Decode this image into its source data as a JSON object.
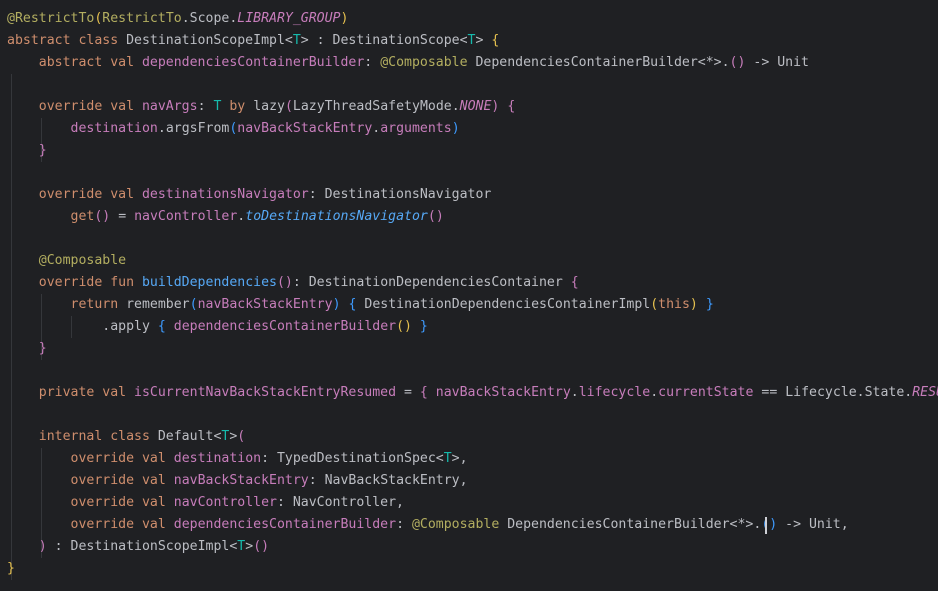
{
  "editor": {
    "language": "kotlin",
    "theme_colors": {
      "background": "#1f2023",
      "keyword": "#cf8e6d",
      "annotation": "#b3ae60",
      "property": "#c77dbb",
      "function": "#56a8f5",
      "type_parameter": "#16baac",
      "plain": "#bcbec4"
    },
    "lines": [
      [
        [
          "anno",
          "@RestrictTo"
        ],
        [
          "br1",
          "("
        ],
        [
          "anno",
          "RestrictTo"
        ],
        [
          "pl",
          ".Scope."
        ],
        [
          "prop ital",
          "LIBRARY_GROUP"
        ],
        [
          "br1",
          ")"
        ]
      ],
      [
        [
          "kw",
          "abstract class "
        ],
        [
          "ty",
          "DestinationScopeImpl"
        ],
        [
          "pl",
          "<"
        ],
        [
          "tp",
          "T"
        ],
        [
          "pl",
          "> : DestinationScope<"
        ],
        [
          "tp",
          "T"
        ],
        [
          "pl",
          "> "
        ],
        [
          "br1",
          "{"
        ]
      ],
      [
        [
          "pl",
          "    "
        ],
        [
          "kw",
          "abstract val "
        ],
        [
          "prop",
          "dependenciesContainerBuilder"
        ],
        [
          "pl",
          ": "
        ],
        [
          "anno",
          "@Composable "
        ],
        [
          "pl",
          "DependenciesContainerBuilder<*>."
        ],
        [
          "br2",
          "()"
        ],
        [
          "pl",
          " -> Unit"
        ]
      ],
      [],
      [
        [
          "pl",
          "    "
        ],
        [
          "kw",
          "override val "
        ],
        [
          "prop",
          "navArgs"
        ],
        [
          "pl",
          ": "
        ],
        [
          "tp",
          "T"
        ],
        [
          "pl",
          " "
        ],
        [
          "kw",
          "by "
        ],
        [
          "pl",
          "lazy"
        ],
        [
          "br2",
          "("
        ],
        [
          "pl",
          "LazyThreadSafetyMode."
        ],
        [
          "prop ital",
          "NONE"
        ],
        [
          "br2",
          ")"
        ],
        [
          "pl",
          " "
        ],
        [
          "br2",
          "{"
        ]
      ],
      [
        [
          "pl",
          "        "
        ],
        [
          "prop",
          "destination"
        ],
        [
          "pl",
          ".argsFrom"
        ],
        [
          "br3",
          "("
        ],
        [
          "prop",
          "navBackStackEntry"
        ],
        [
          "pl",
          "."
        ],
        [
          "prop",
          "arguments"
        ],
        [
          "br3",
          ")"
        ]
      ],
      [
        [
          "pl",
          "    "
        ],
        [
          "br2",
          "}"
        ]
      ],
      [],
      [
        [
          "pl",
          "    "
        ],
        [
          "kw",
          "override val "
        ],
        [
          "prop",
          "destinationsNavigator"
        ],
        [
          "pl",
          ": DestinationsNavigator"
        ]
      ],
      [
        [
          "pl",
          "        "
        ],
        [
          "kw",
          "get"
        ],
        [
          "br2",
          "()"
        ],
        [
          "pl",
          " = "
        ],
        [
          "prop",
          "navController"
        ],
        [
          "pl",
          "."
        ],
        [
          "fn ital",
          "toDestinationsNavigator"
        ],
        [
          "br2",
          "()"
        ]
      ],
      [],
      [
        [
          "pl",
          "    "
        ],
        [
          "anno",
          "@Composable"
        ]
      ],
      [
        [
          "pl",
          "    "
        ],
        [
          "kw",
          "override fun "
        ],
        [
          "fn",
          "buildDependencies"
        ],
        [
          "br2",
          "()"
        ],
        [
          "pl",
          ": DestinationDependenciesContainer "
        ],
        [
          "br2",
          "{"
        ]
      ],
      [
        [
          "pl",
          "        "
        ],
        [
          "kw",
          "return "
        ],
        [
          "pl",
          "remember"
        ],
        [
          "br3",
          "("
        ],
        [
          "prop",
          "navBackStackEntry"
        ],
        [
          "br3",
          ")"
        ],
        [
          "pl",
          " "
        ],
        [
          "br3",
          "{"
        ],
        [
          "pl",
          " DestinationDependenciesContainerImpl"
        ],
        [
          "br1",
          "("
        ],
        [
          "kw",
          "this"
        ],
        [
          "br1",
          ")"
        ],
        [
          "pl",
          " "
        ],
        [
          "br3",
          "}"
        ]
      ],
      [
        [
          "pl",
          "            .apply "
        ],
        [
          "br3",
          "{"
        ],
        [
          "pl",
          " "
        ],
        [
          "prop",
          "dependenciesContainerBuilder"
        ],
        [
          "br1",
          "()"
        ],
        [
          "pl",
          " "
        ],
        [
          "br3",
          "}"
        ]
      ],
      [
        [
          "pl",
          "    "
        ],
        [
          "br2",
          "}"
        ]
      ],
      [],
      [
        [
          "pl",
          "    "
        ],
        [
          "kw",
          "private val "
        ],
        [
          "prop",
          "isCurrentNavBackStackEntryResumed"
        ],
        [
          "pl",
          " = "
        ],
        [
          "br2",
          "{"
        ],
        [
          "pl",
          " "
        ],
        [
          "prop",
          "navBackStackEntry"
        ],
        [
          "pl",
          "."
        ],
        [
          "prop",
          "lifecycle"
        ],
        [
          "pl",
          "."
        ],
        [
          "prop",
          "currentState"
        ],
        [
          "pl",
          " == Lifecycle.State."
        ],
        [
          "prop ital",
          "RESUMED"
        ],
        [
          "pl",
          " "
        ],
        [
          "br2",
          "}"
        ]
      ],
      [],
      [
        [
          "pl",
          "    "
        ],
        [
          "kw",
          "internal class "
        ],
        [
          "ty",
          "Default"
        ],
        [
          "pl",
          "<"
        ],
        [
          "tp",
          "T"
        ],
        [
          "pl",
          ">"
        ],
        [
          "br2",
          "("
        ]
      ],
      [
        [
          "pl",
          "        "
        ],
        [
          "kw",
          "override val "
        ],
        [
          "prop",
          "destination"
        ],
        [
          "pl",
          ": TypedDestinationSpec<"
        ],
        [
          "tp",
          "T"
        ],
        [
          "pl",
          ">,"
        ]
      ],
      [
        [
          "pl",
          "        "
        ],
        [
          "kw",
          "override val "
        ],
        [
          "prop",
          "navBackStackEntry"
        ],
        [
          "pl",
          ": NavBackStackEntry,"
        ]
      ],
      [
        [
          "pl",
          "        "
        ],
        [
          "kw",
          "override val "
        ],
        [
          "prop",
          "navController"
        ],
        [
          "pl",
          ": NavController,"
        ]
      ],
      [
        [
          "pl",
          "        "
        ],
        [
          "kw",
          "override val "
        ],
        [
          "prop",
          "dependenciesContainerBuilder"
        ],
        [
          "pl",
          ": "
        ],
        [
          "anno",
          "@Composable "
        ],
        [
          "pl",
          "DependenciesContainerBuilder<*>."
        ],
        [
          "br3",
          "()"
        ],
        [
          "pl",
          " -> Unit,"
        ]
      ],
      [
        [
          "pl",
          "    "
        ],
        [
          "br2",
          ")"
        ],
        [
          "pl",
          " : DestinationScopeImpl<"
        ],
        [
          "tp",
          "T"
        ],
        [
          "pl",
          ">"
        ],
        [
          "br2",
          "()"
        ]
      ],
      [
        [
          "br1",
          "}"
        ]
      ]
    ]
  }
}
